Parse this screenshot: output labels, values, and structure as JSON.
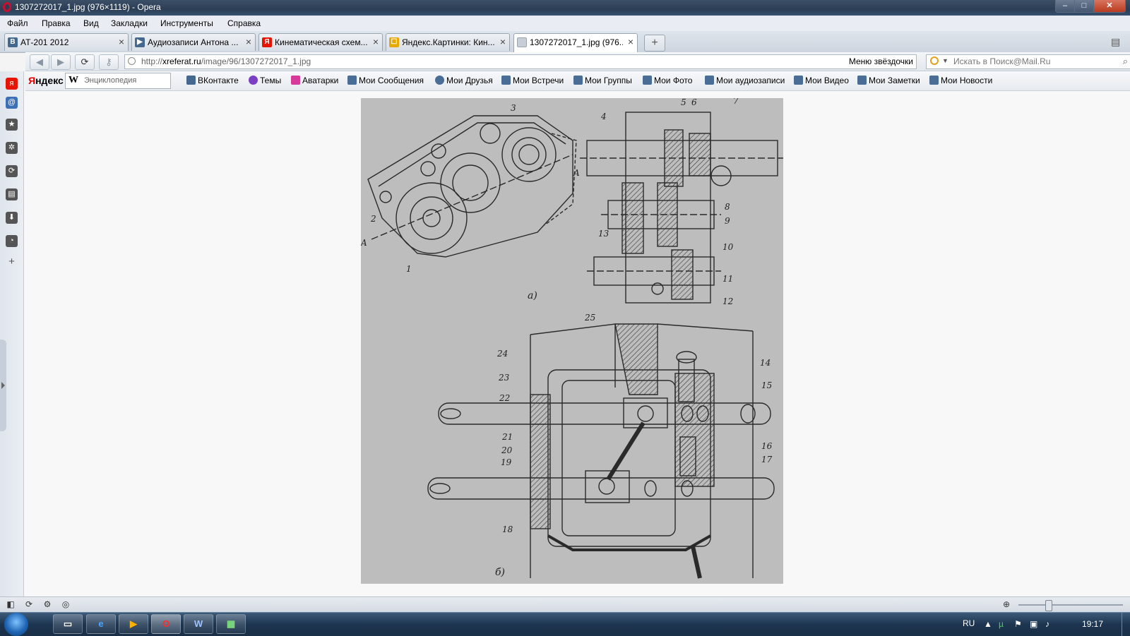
{
  "window": {
    "title": "1307272017_1.jpg (976×1119) - Opera",
    "controls": {
      "minimize": "–",
      "maximize": "□",
      "close": "✕"
    }
  },
  "menu": [
    "Файл",
    "Правка",
    "Вид",
    "Закладки",
    "Инструменты",
    "Справка"
  ],
  "tabs": [
    {
      "label": "АТ-201 2012",
      "icon": "vk-icon",
      "icon_text": "В",
      "color": "#45688e"
    },
    {
      "label": "Аудиозаписи Антона ...",
      "icon": "play-icon",
      "icon_text": "▶",
      "color": "#45688e"
    },
    {
      "label": "Кинематическая схем...",
      "icon": "yandex-icon",
      "icon_text": "Я",
      "color": "#e61400"
    },
    {
      "label": "Яндекс.Картинки: Кин...",
      "icon": "yandex-images-icon",
      "icon_text": "☐",
      "color": "#e7a800"
    },
    {
      "label": "1307272017_1.jpg (976...",
      "icon": "image-icon",
      "icon_text": "",
      "color": "#9aa5b2",
      "active": true
    }
  ],
  "newtab": "+",
  "address": {
    "url_prefix": "http://",
    "url_domain": "xreferat.ru",
    "url_path": "/image/96/1307272017_1.jpg",
    "bookmarks_label": "Меню звёздочки",
    "search_placeholder": "Искать в Поиск@Mail.Ru"
  },
  "yandex_bar": {
    "logo": "Яндекс",
    "wiki_letter": "W",
    "wiki_placeholder": "Энциклопедия",
    "links": [
      {
        "label": "ВКонтакте",
        "icon": "vk-icon",
        "color": "#45688e"
      },
      {
        "label": "Темы",
        "icon": "heart-icon",
        "color": "#7b3fc4"
      },
      {
        "label": "Аватарки",
        "icon": "star-icon",
        "color": "#d83a9a"
      },
      {
        "label": "Мои Сообщения",
        "icon": "envelope-icon",
        "color": "#4a6d96"
      },
      {
        "label": "Мои Друзья",
        "icon": "person-icon",
        "color": "#4a6d96"
      },
      {
        "label": "Мои Встречи",
        "icon": "house-icon",
        "color": "#4a6d96"
      },
      {
        "label": "Мои Группы",
        "icon": "group-icon",
        "color": "#4a6d96"
      },
      {
        "label": "Мои Фото",
        "icon": "camera-icon",
        "color": "#4a6d96"
      },
      {
        "label": "Мои аудиозаписи",
        "icon": "speaker-icon",
        "color": "#4a6d96"
      },
      {
        "label": "Мои Видео",
        "icon": "film-icon",
        "color": "#4a6d96"
      },
      {
        "label": "Мои Заметки",
        "icon": "note-icon",
        "color": "#4a6d96"
      },
      {
        "label": "Мои Новости",
        "icon": "plus-icon",
        "color": "#4a6d96"
      }
    ]
  },
  "sidepanel": [
    {
      "icon": "yandex-icon",
      "text": "я",
      "color": "#e61400"
    },
    {
      "icon": "mail-icon",
      "text": "@",
      "color": "#3b6fb6"
    },
    {
      "icon": "star-icon",
      "text": "★",
      "color": "#555"
    },
    {
      "icon": "settings-icon",
      "text": "✲",
      "color": "#555"
    },
    {
      "icon": "unite-icon",
      "text": "⟳",
      "color": "#555"
    },
    {
      "icon": "notes-icon",
      "text": "▤",
      "color": "#555"
    },
    {
      "icon": "download-icon",
      "text": "⬇",
      "color": "#555"
    },
    {
      "icon": "history-icon",
      "text": "◔",
      "color": "#555"
    },
    {
      "icon": "add-panel-icon",
      "text": "+",
      "color": "#555"
    }
  ],
  "drawing": {
    "numbers": [
      "3",
      "4",
      "5",
      "6",
      "7",
      "2",
      "8",
      "9",
      "10",
      "11",
      "12",
      "13",
      "1",
      "25",
      "24",
      "23",
      "22",
      "21",
      "20",
      "19",
      "18",
      "14",
      "15",
      "16",
      "17"
    ],
    "section_markers": [
      "A",
      "A"
    ],
    "captions": [
      "а)",
      "б)"
    ]
  },
  "taskbar": {
    "lang": "RU",
    "clock": "19:17",
    "apps": [
      {
        "icon": "explorer-icon",
        "text": "▭"
      },
      {
        "icon": "ie-icon",
        "text": "e"
      },
      {
        "icon": "media-player-icon",
        "text": "▶"
      },
      {
        "icon": "opera-icon",
        "text": "O",
        "active": true
      },
      {
        "icon": "word-icon",
        "text": "W"
      },
      {
        "icon": "calc-icon",
        "text": "▦"
      }
    ]
  }
}
